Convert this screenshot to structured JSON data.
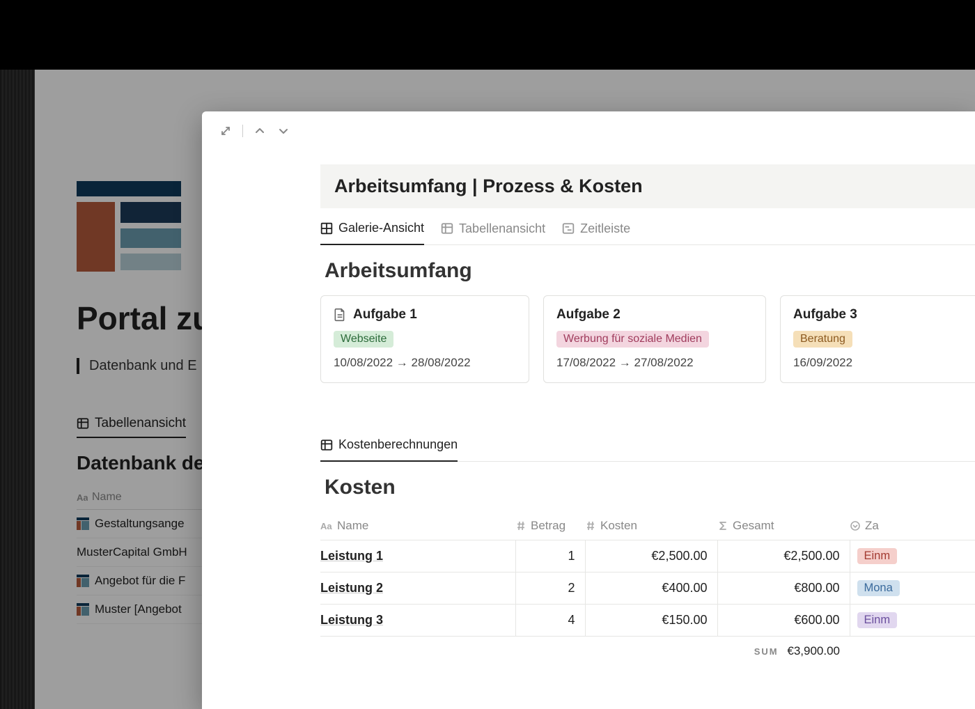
{
  "background": {
    "title": "Portal zu",
    "subtitle": "Datenbank und E",
    "tab": "Tabellenansicht",
    "db_header": "Datenbank de",
    "name_col": "Name",
    "rows": [
      "Gestaltungsange",
      "MusterCapital GmbH",
      "Angebot für die F",
      "Muster [Angebot"
    ]
  },
  "modal": {
    "block_title": "Arbeitsumfang | Prozess & Kosten",
    "tabs1": [
      {
        "label": "Galerie-Ansicht",
        "icon": "gallery",
        "active": true
      },
      {
        "label": "Tabellenansicht",
        "icon": "table",
        "active": false
      },
      {
        "label": "Zeitleiste",
        "icon": "timeline",
        "active": false
      }
    ],
    "section1": "Arbeitsumfang",
    "cards": [
      {
        "title": "Aufgabe 1",
        "has_icon": true,
        "tag": "Webseite",
        "tag_class": "green",
        "date": "10/08/2022 → 28/08/2022"
      },
      {
        "title": "Aufgabe 2",
        "has_icon": false,
        "tag": "Werbung für soziale Medien",
        "tag_class": "pink",
        "date": "17/08/2022 → 27/08/2022"
      },
      {
        "title": "Aufgabe 3",
        "has_icon": false,
        "tag": "Beratung",
        "tag_class": "orange",
        "date": "16/09/2022"
      }
    ],
    "tabs2": [
      {
        "label": "Kostenberechnungen",
        "icon": "table",
        "active": true
      }
    ],
    "section2": "Kosten",
    "columns": {
      "name": "Name",
      "betrag": "Betrag",
      "kosten": "Kosten",
      "gesamt": "Gesamt",
      "za": "Za"
    },
    "rows": [
      {
        "name": "Leistung 1",
        "betrag": "1",
        "kosten": "€2,500.00",
        "gesamt": "€2,500.00",
        "pill": "Einm",
        "pill_class": "red"
      },
      {
        "name": "Leistung 2",
        "betrag": "2",
        "kosten": "€400.00",
        "gesamt": "€800.00",
        "pill": "Mona",
        "pill_class": "blue"
      },
      {
        "name": "Leistung 3",
        "betrag": "4",
        "kosten": "€150.00",
        "gesamt": "€600.00",
        "pill": "Einm",
        "pill_class": "purple"
      }
    ],
    "sum_label": "SUM",
    "sum_value": "€3,900.00"
  }
}
